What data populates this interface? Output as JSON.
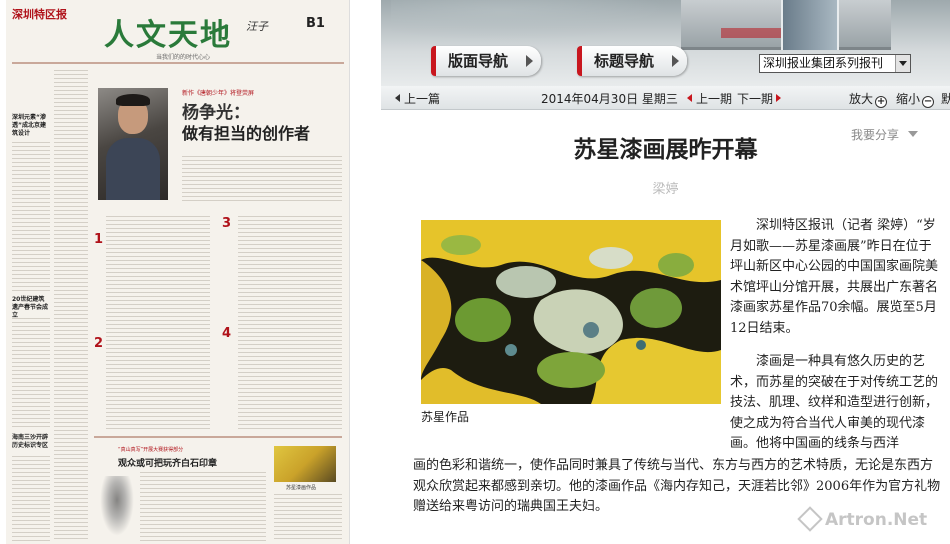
{
  "newspaper": {
    "logo": "深圳特区报",
    "section_title": "人文天地",
    "section_sign": "汪子",
    "page_number": "B1",
    "slogan": "当我们的的时代心心",
    "feature_kicker": "新作《唐朝少年》将登荧屏",
    "feature_title_1": "杨争光：",
    "feature_title_2": "做有担当的创作者",
    "numbers": [
      "1",
      "2",
      "3",
      "4"
    ],
    "sidebar_heads": [
      "深圳元素“渗透”成北京建筑设计",
      "20世纪建筑遗产春节会成立",
      "海南三沙开辟历史标识专区"
    ],
    "bottom_kicker": "“真山真写”开展大赛获得部分",
    "bottom_title": "观众或可把玩齐白石印章",
    "bottom_caption": "苏星漆画作品"
  },
  "header": {
    "nav_tab_layout": "版面导航",
    "nav_tab_title": "标题导航",
    "group_select": "深圳报业集团系列报刊"
  },
  "toolbar": {
    "prev_article": "上一篇",
    "date": "2014年04月30日 星期三",
    "prev_issue": "上一期",
    "next_issue": "下一期",
    "zoom_in": "放大",
    "zoom_out": "缩小",
    "zoom_in_symbol": "+",
    "zoom_out_symbol": "−",
    "cut_off": "默"
  },
  "article": {
    "share": "我要分享",
    "headline": "苏星漆画展昨开幕",
    "author": "梁婷",
    "photo_caption": "苏星作品",
    "para1": "深圳特区报讯（记者 梁婷）“岁月如歌——苏星漆画展”昨日在位于坪山新区中心公园的中国国家画院美术馆坪山分馆开展，共展出广东著名漆画家苏星作品70余幅。展览至5月12日结束。",
    "para2": "漆画是一种具有悠久历史的艺术，而苏星的突破在于对传统工艺的技法、肌理、纹样和造型进行创新，使之成为符合当代人审美的现代漆画。他将中国画的线条与西洋",
    "para3": "画的色彩和谐统一，使作品同时兼具了传统与当代、东方与西方的艺术特质，无论是东西方观众欣赏起来都感到亲切。他的漆画作品《海内存知己，天涯若比邻》2006年作为官方礼物赠送给来粤访问的瑞典国王夫妇。",
    "watermark": "Artron.Net"
  },
  "colors": {
    "brand_red": "#c8161e",
    "section_green": "#2a7a3a",
    "painting_yellow": "#e3c52c"
  }
}
